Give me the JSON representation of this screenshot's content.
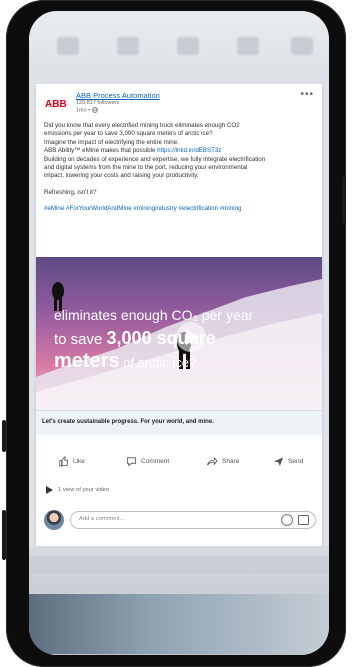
{
  "post": {
    "company_name": "ABB Process Automation",
    "logo_text": "ABB",
    "followers": "120,817 followers",
    "time": "1mo • ",
    "more_label": "•••",
    "body_line1": "Did you know that every electrified mining truck eliminates enough CO2",
    "body_line2": "emissions per year to save 3,000 square meters of arctic ice?",
    "body_line3": "Imagine the impact of electrifying the entire mine.",
    "body_line4_prefix": "ABB Ability™ eMine makes that possible ",
    "body_link": "https://lnkd.in/dEBST3z",
    "body_line5": "Building on decades of experience and expertise, we fully integrate electrification",
    "body_line6": "and digital systems from the mine to the port, reducing your environmental",
    "body_line7": "impact, lowering your costs and raising your productivity.",
    "body_line8": "Refreshing, isn't it?",
    "hashtags": "#eMine #ForYourWorldAndMine #miningindustry #electrification #mining"
  },
  "video": {
    "overlay_line1": "eliminates enough CO₂ per year",
    "overlay_line2_prefix": "to save ",
    "overlay_line2_emph": "3,000 square",
    "overlay_line3_emph": "meters",
    "overlay_line3_suffix": " of arctic ice?",
    "caption": "Let's create sustainable progress. For your world, and mine."
  },
  "actions": {
    "like": "Like",
    "comment": "Comment",
    "share": "Share",
    "send": "Send"
  },
  "stats": {
    "views": "1 view of your video"
  },
  "comment": {
    "placeholder": "Add a comment..."
  }
}
